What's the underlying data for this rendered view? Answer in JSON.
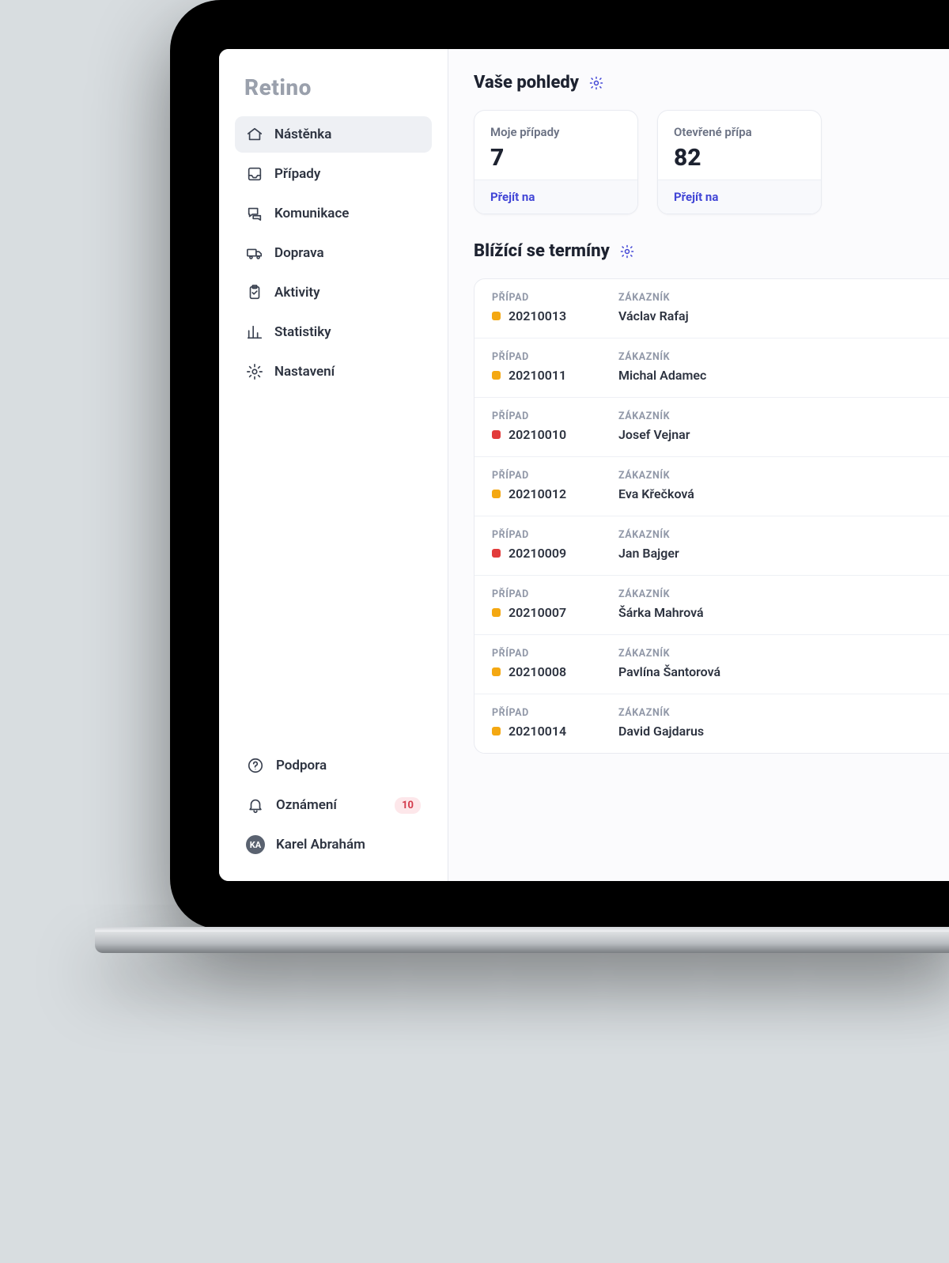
{
  "brand": "Retino",
  "sidebar": {
    "items": [
      {
        "label": "Nástěnka",
        "icon": "home",
        "active": true
      },
      {
        "label": "Případy",
        "icon": "inbox",
        "active": false
      },
      {
        "label": "Komunikace",
        "icon": "chat",
        "active": false
      },
      {
        "label": "Doprava",
        "icon": "truck",
        "active": false
      },
      {
        "label": "Aktivity",
        "icon": "clipboard",
        "active": false
      },
      {
        "label": "Statistiky",
        "icon": "chart",
        "active": false
      },
      {
        "label": "Nastavení",
        "icon": "gear",
        "active": false
      }
    ],
    "support_label": "Podpora",
    "notifications_label": "Oznámení",
    "notifications_count": "10",
    "user_initials": "KA",
    "user_name": "Karel Abrahám"
  },
  "views": {
    "title": "Vaše pohledy",
    "cards": [
      {
        "title": "Moje případy",
        "value": "7",
        "cta": "Přejít na"
      },
      {
        "title": "Otevřené přípa",
        "value": "82",
        "cta": "Přejít na"
      }
    ]
  },
  "deadlines": {
    "title": "Blížící se termíny",
    "col_case": "PŘÍPAD",
    "col_customer": "ZÁKAZNÍK",
    "rows": [
      {
        "id": "20210013",
        "status": "orange",
        "customer": "Václav Rafaj"
      },
      {
        "id": "20210011",
        "status": "orange",
        "customer": "Michal Adamec"
      },
      {
        "id": "20210010",
        "status": "red",
        "customer": "Josef Vejnar"
      },
      {
        "id": "20210012",
        "status": "orange",
        "customer": "Eva Křečková"
      },
      {
        "id": "20210009",
        "status": "red",
        "customer": "Jan Bajger"
      },
      {
        "id": "20210007",
        "status": "orange",
        "customer": "Šárka Mahrová"
      },
      {
        "id": "20210008",
        "status": "orange",
        "customer": "Pavlína Šantorová"
      },
      {
        "id": "20210014",
        "status": "orange",
        "customer": "David Gajdarus"
      }
    ]
  }
}
